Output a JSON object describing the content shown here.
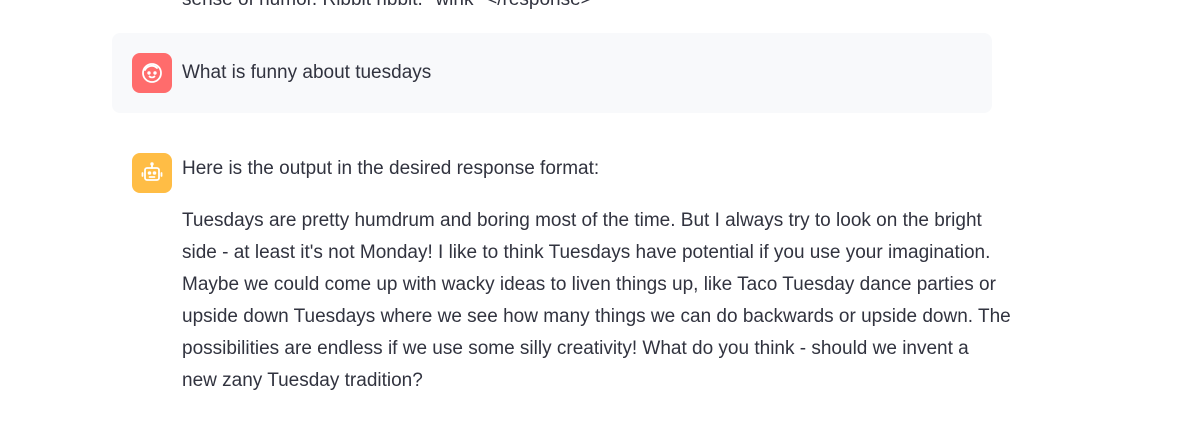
{
  "previous_message": {
    "cutoff_text": "sense of humor. Ribbit ribbit. *wink* </response>"
  },
  "user_message": {
    "avatar_icon": "user-face-icon",
    "avatar_color": "#ff6c6c",
    "text": "What is funny about tuesdays"
  },
  "assistant_message": {
    "avatar_icon": "robot-icon",
    "avatar_color": "#ffbd45",
    "intro": "Here is the output in the desired response format:",
    "body_lines": [
      "Tuesdays are pretty humdrum and boring most of the time. But I always try to look on the bright",
      "side - at least it's not Monday! I like to think Tuesdays have potential if you use your imagination.",
      "Maybe we could come up with wacky ideas to liven things up, like Taco Tuesday dance parties or",
      "upside down Tuesdays where we see how many things we can do backwards or upside down. The",
      "possibilities are endless if we use some silly creativity! What do you think - should we invent a",
      "new zany Tuesday tradition?"
    ]
  }
}
